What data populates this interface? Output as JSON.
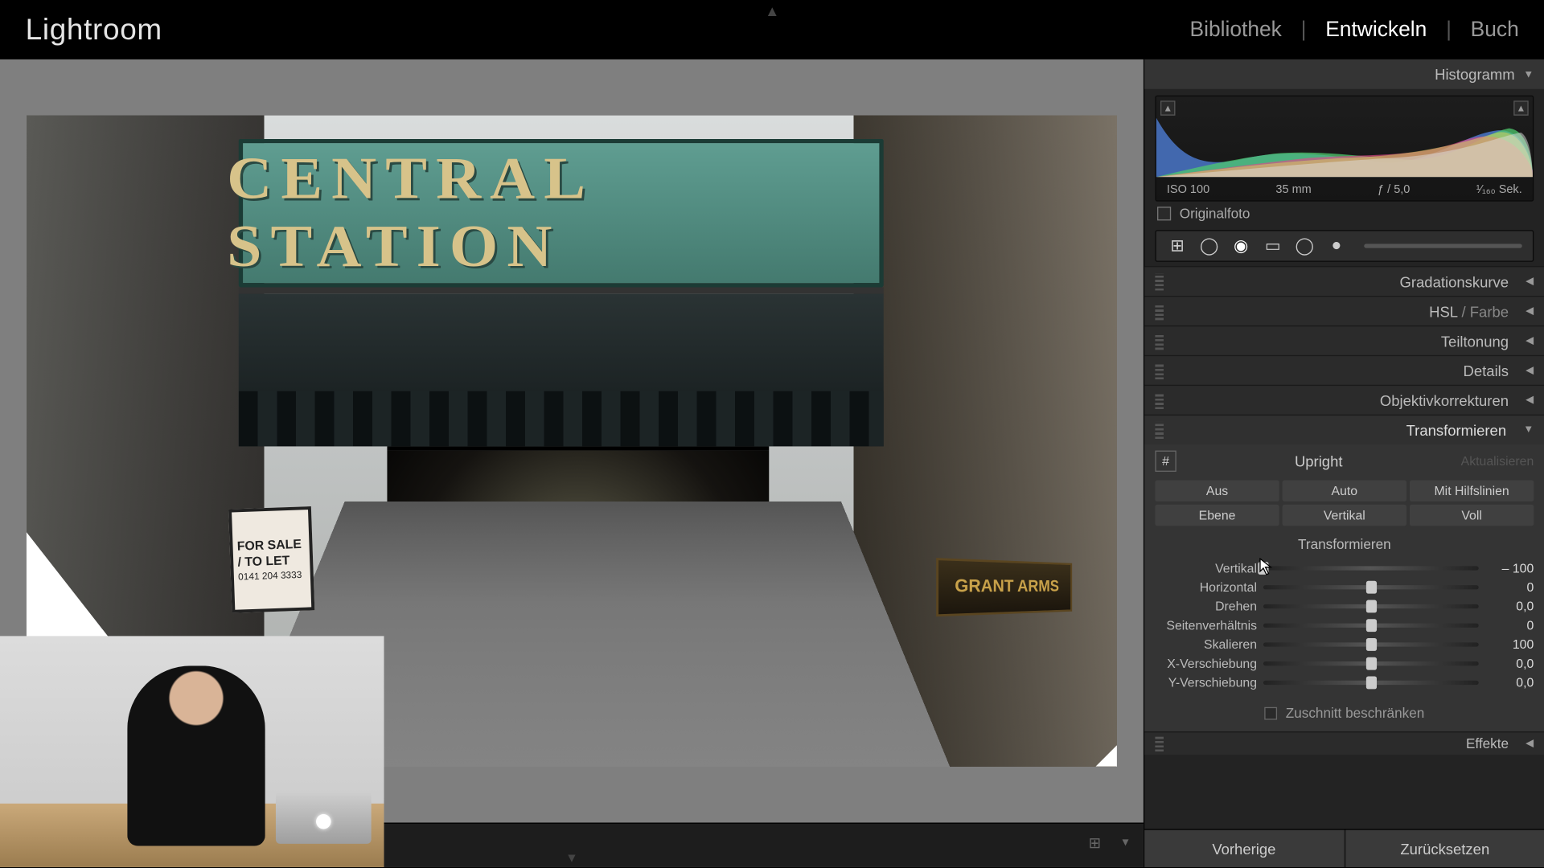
{
  "app_title": "Lightroom",
  "modules": {
    "library": "Bibliothek",
    "develop": "Entwickeln",
    "book": "Buch",
    "active": "develop"
  },
  "histogram": {
    "title": "Histogramm",
    "meta": {
      "iso": "ISO 100",
      "focal": "35 mm",
      "aperture": "ƒ / 5,0",
      "shutter": "¹⁄₁₆₀ Sek."
    },
    "original_label": "Originalfoto",
    "original_checked": false
  },
  "panels": {
    "tone_curve": "Gradationskurve",
    "hsl_prefix": "HSL",
    "hsl_suffix": "Farbe",
    "split_toning": "Teiltonung",
    "detail": "Details",
    "lens_corr": "Objektivkorrekturen",
    "transform": "Transformieren",
    "effects": "Effekte"
  },
  "transform": {
    "upright_label": "Upright",
    "update_label": "Aktualisieren",
    "buttons_row1": [
      "Aus",
      "Auto",
      "Mit Hilfslinien"
    ],
    "buttons_row2": [
      "Ebene",
      "Vertikal",
      "Voll"
    ],
    "section_label": "Transformieren",
    "sliders": [
      {
        "label": "Vertikal",
        "value": "– 100",
        "pos": 0
      },
      {
        "label": "Horizontal",
        "value": "0",
        "pos": 50
      },
      {
        "label": "Drehen",
        "value": "0,0",
        "pos": 50
      },
      {
        "label": "Seitenverhältnis",
        "value": "0",
        "pos": 50
      },
      {
        "label": "Skalieren",
        "value": "100",
        "pos": 50
      },
      {
        "label": "X-Verschiebung",
        "value": "0,0",
        "pos": 50
      },
      {
        "label": "Y-Verschiebung",
        "value": "0,0",
        "pos": 50
      }
    ],
    "constrain_label": "Zuschnitt beschränken",
    "constrain_checked": false
  },
  "footer": {
    "previous": "Vorherige",
    "reset": "Zurücksetzen"
  },
  "image": {
    "sign_text": "CENTRAL STATION",
    "for_sale_line1": "FOR SALE",
    "for_sale_line2": "/ TO LET",
    "for_sale_phone": "0141 204 3333",
    "grant_text": "GRANT ARMS"
  }
}
